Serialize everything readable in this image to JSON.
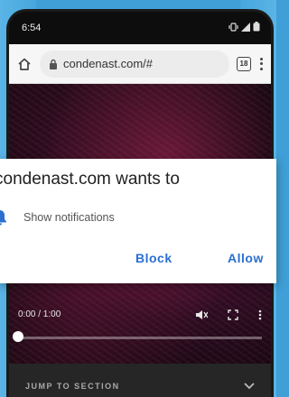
{
  "status_bar": {
    "time": "6:54",
    "icons": [
      "vibrate-icon",
      "signal-icon",
      "battery-icon"
    ]
  },
  "address_bar": {
    "url": "condenast.com/#",
    "tab_count": "18"
  },
  "video": {
    "time_display": "0:00 / 1:00",
    "progress": 0.0
  },
  "jump_section": {
    "label": "JUMP TO SECTION"
  },
  "permission_dialog": {
    "title": "condenast.com wants to",
    "permission": "Show notifications",
    "block_label": "Block",
    "allow_label": "Allow"
  },
  "colors": {
    "accent": "#2b6fd0",
    "background": "#3f9fd6"
  }
}
